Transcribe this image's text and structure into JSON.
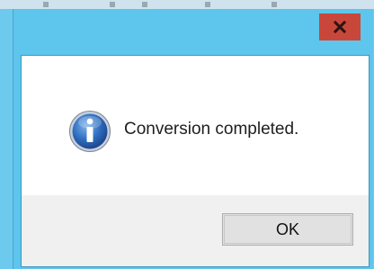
{
  "dialog": {
    "message": "Conversion completed.",
    "ok_label": "OK",
    "close_glyph": "x"
  },
  "icons": {
    "close": "close-icon",
    "info": "info-icon"
  },
  "colors": {
    "title_bar": "#5ec5ec",
    "close_button": "#c9473a",
    "content_bg": "#ffffff",
    "footer_bg": "#f0f0f0",
    "info_blue": "#2f6fbf"
  }
}
